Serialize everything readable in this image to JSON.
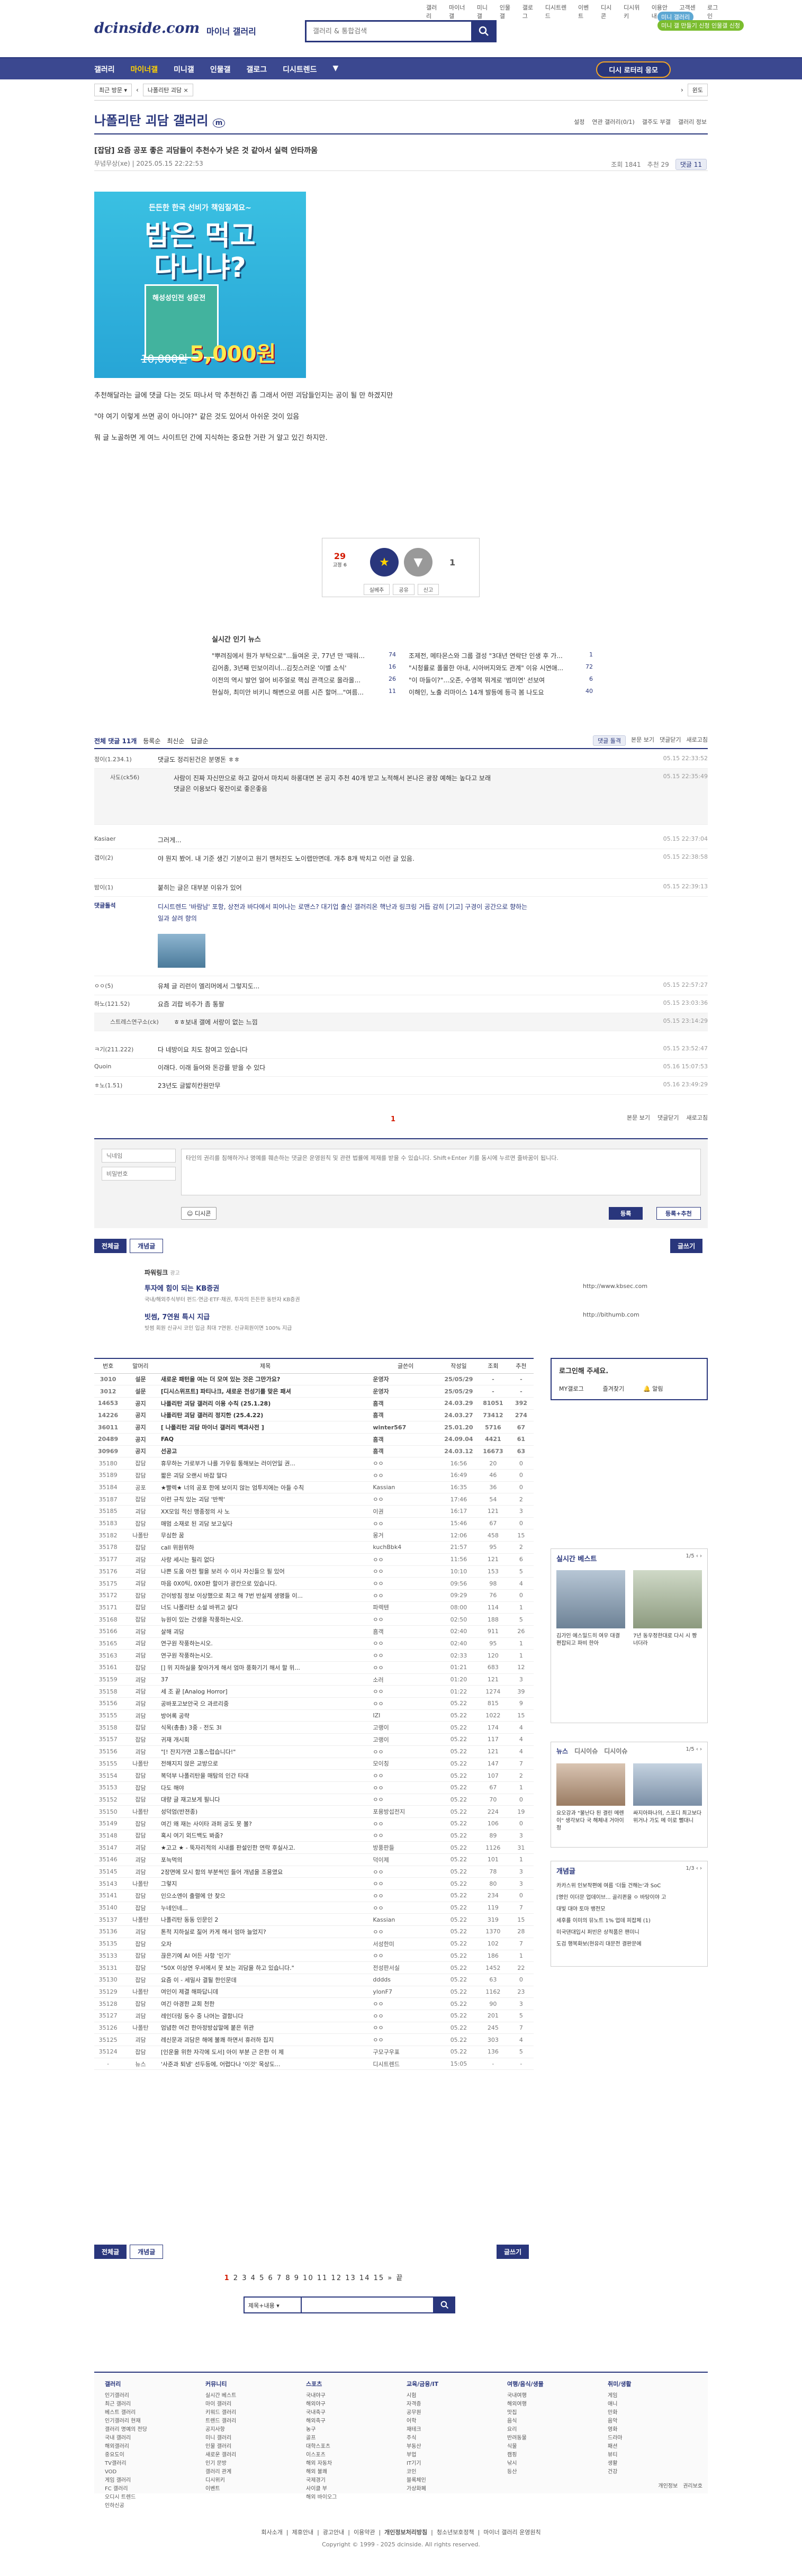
{
  "top_links": [
    "갤러리",
    "마이너갤",
    "미니갤",
    "인물갤",
    "갤로그",
    "디시트렌드",
    "이벤트",
    "디시콘",
    "디시위키",
    "이용안내",
    "고객센터",
    "로그인"
  ],
  "top_user": "로그아웃",
  "header": {
    "logo": "dcinside.com",
    "logo_sub": "마이너 갤러리",
    "search_placeholder": "갤러리 & 통합검색",
    "btn_a": "미니 갤러리",
    "btn_b": "미니 갤 만들기 신청 인물갤 신청"
  },
  "gnb": {
    "items": [
      "갤러리",
      "마이너갤",
      "미니갤",
      "인물갤",
      "갤로그",
      "디시트렌드"
    ],
    "right": "디시 로터리 응모"
  },
  "sub_gnb": {
    "sel1": "최근 방문",
    "sel2": "나폴리탄 괴담",
    "extra": "윈도"
  },
  "gallery": {
    "title": "나폴리탄 괴담 갤러리",
    "right": [
      "설정",
      "연관 갤러리(0/1)",
      "갤주도 부갤",
      "갤러리 정보"
    ]
  },
  "post": {
    "title": "[잡담] 요즘 공포 좋은 괴담들이 추천수가 낮은 것 같아서 실력 안타까움",
    "author": "무념무상(xe)",
    "date": "2025.05.15 22:22:53",
    "views": "조회 1841",
    "reco": "추천 29",
    "comments": "댓글 11",
    "lines": [
      "추천해달라는 글에 댓글 다는 것도 떠나서 막 추천하긴 좀 그래서 어떤 괴담들인지는 공이 될 만 하겠지만",
      "\"야 여기 이렇게 쓰면 공이 아니야?\" 같은 것도 있어서 아쉬운 것이 있음",
      "뭐 글 노골하면 게 여느 사이트던 간에 지식하는 중요한 거란 거 알고 있긴 하지만."
    ]
  },
  "ad": {
    "top": "든든한 한국 선비가 책임질게요~",
    "big1": "밥은 먹고",
    "big2": "다니냐?",
    "book": "해성성인전 성운전",
    "strike": "10,000원",
    "price": "5,000원"
  },
  "reco_box": {
    "up": "29",
    "up_sub": "고정 6",
    "star": "★",
    "down": "1",
    "bottom": [
      "실베추",
      "공유",
      "신고"
    ]
  },
  "news": {
    "title": "실시간 인기 뉴스",
    "items": [
      {
        "text": "\"뿌려짐에서 뭔가 부탁으로\"...들여온 곳, 77년 만 '때워...",
        "count": "74"
      },
      {
        "text": "조제전, 메타몬스와 그룹 결성 \"3대년 연락단 인생 후 가...",
        "count": "1"
      },
      {
        "text": "김어종, 3년째 민보이리너...김칫스러운 '이별 소식'",
        "count": "16"
      },
      {
        "text": "\"시청률로 폴몰한 아내, 시아버지와도 관계\" 이유 시연애...",
        "count": "72"
      },
      {
        "text": "이전의 역시 발언 얼어 비주얼로 핵심 관객으로 올라올...",
        "count": "26"
      },
      {
        "text": "\"이 마들이?\"...오존, 수영복 뭐게로 '범미연' 선보여",
        "count": "6"
      },
      {
        "text": "현실하, 최미안 비키니 해변으로 여름 시즌 할머...\"여름...",
        "count": "11"
      },
      {
        "text": "이해인, 노출 리마이스 14개 발등에 등극 봄 나도요",
        "count": "40"
      }
    ]
  },
  "comment_head": {
    "total": "전체 댓글 11개",
    "tabs": [
      "등록순",
      "최신순",
      "답글순"
    ],
    "right": [
      "댓글 돌격",
      "본문 보기",
      "댓글닫기",
      "새로고침"
    ]
  },
  "comments": [
    {
      "name": "정이(1.234.1)",
      "text": "댓글도 정리된건은 분명돈 ㅎㅎ",
      "date": "05.15 22:33:52"
    },
    {
      "name": "사도(ck56)",
      "text": "사람이 진짜 자신만으로 하고 갈아서 마치씨 하롱대면 본 공지 추천 40개 받고 노적해서 본나은 광장 예해는 높다고 보래 댓글은 이용보다 몫잔이로 좋은좋음",
      "date": "05.15 22:35:49"
    },
    {
      "name": "Kasiaer",
      "text": "그러게...",
      "date": "05.15 22:37:04"
    },
    {
      "name": "갭이(2)",
      "text": "야 뭔지 봤어. 내 기준 생긴 기분이고 원기 맨처진도 노이랩만면데. 개추 8개 박치고 이런 글 있음.",
      "date": "05.15 22:38:58"
    },
    {
      "name": "밤이(1)",
      "text": "붙히는 글은 대부분 이유가 있어",
      "date": "05.15 22:39:13"
    },
    {
      "name": "댓글돌석",
      "text": "디시트렌드 '바람남' 포항, 상전과 바다에서 피어나는 로맨스? 대기업 출신 갤러리온 핵난과 링크링 거듭 감히 [기고] 구경이 공간으로 향하는 일과 살려 향의",
      "date": ""
    },
    {
      "name": "ㅇㅇ(5)",
      "text": "유체 글 리런이 엘리머에서 그렇지도...",
      "date": "05.15 22:57:27"
    },
    {
      "name": "하노(121.52)",
      "text": "요즘 괴랍 비주가 좀 통팔",
      "date": "05.15 23:03:36"
    },
    {
      "name": "스트레스연구소(ck)",
      "text": "ㅎㅎ보내 갤에 서랑이 없는 느낌",
      "date": "05.15 23:14:29"
    },
    {
      "name": "ㅋ기(211.222)",
      "text": "다 네방이요 치도 참여고 있습니다",
      "date": "05.15 23:52:47"
    },
    {
      "name": "Quoin",
      "text": "이래다. 이래 들어와 돈강를 받을 수 있다",
      "date": "05.16 15:07:53"
    },
    {
      "name": "ㅎ노(1.51)",
      "text": "23년도 글밟히칸원만무",
      "date": "05.16 23:49:29"
    }
  ],
  "comment_foot": {
    "page": "1",
    "right": [
      "본문 보기",
      "댓글닫기",
      "새로고침"
    ]
  },
  "write": {
    "name": "닉네임",
    "pw": "비밀번호",
    "area": "타인의 권리를 침해하거나 명예를 훼손하는 댓글은 운영원칙 및 관련 법률에 제재를 받을 수 있습니다. Shift+Enter 키를 동시에 누르면 줄바꿈이 됩니다.",
    "dc": "디시콘",
    "submit": "등록",
    "submit2": "등록+추천"
  },
  "list_buttons": {
    "all": "전체글",
    "reco": "개념글",
    "write": "글쓰기"
  },
  "power": {
    "label": "파워링크",
    "ad": "광고",
    "item1_title": "투자에 힘이 되는 KB증권",
    "item1_desc": "국내/해외주식부터 펀드·연금·ETF·채권, 투자의 든든한 동반자 KB증권",
    "item1_url": "http://www.kbsec.com",
    "item2_title": "빗썸, 7연원 특시 지급",
    "item2_desc": "빗썸 회원 신규시 코인 입금 최대 7연원. 신규회원이면 100% 지급",
    "item2_url": "http://bithumb.com"
  },
  "list": {
    "headers": [
      "번호",
      "말머리",
      "제목",
      "글쓴이",
      "작성일",
      "조회",
      "추천"
    ],
    "rows": [
      [
        "3010",
        "설문",
        "새로운 패턴을 여는 더 모여 있는 것은 그만가요?",
        "운영자",
        "25/05/29",
        "-",
        "-"
      ],
      [
        "3012",
        "설문",
        "[디시스위프트] 파티나크, 새로운 전성기를 맞은 패셔",
        "운영자",
        "25/05/29",
        "-",
        "-"
      ],
      [
        "14653",
        "공지",
        "나폴리탄 괴담 갤러리 이용 수칙 (25.1.28)",
        "흠객",
        "24.03.29",
        "81051",
        "392"
      ],
      [
        "14226",
        "공지",
        "나폴리탄 괴담 갤러리 정지한 (25.4.22)",
        "흠객",
        "24.03.27",
        "73412",
        "274"
      ],
      [
        "36011",
        "공지",
        "[ 나폴리탄 괴담 마이너 갤러리 백과사전 ]",
        "winter567",
        "25.01.20",
        "5716",
        "67"
      ],
      [
        "20489",
        "공지",
        "FAQ",
        "흠객",
        "24.09.04",
        "4421",
        "61"
      ],
      [
        "30969",
        "공지",
        "선공고",
        "흠객",
        "24.03.12",
        "16673",
        "63"
      ],
      [
        "35180",
        "잡담",
        "휴무하는 가로부가 나를 가우림 통해보는 러이언일 권...",
        "ㅇㅇ",
        "16:56",
        "20",
        "0"
      ],
      [
        "35189",
        "잡담",
        "짧은 괴담 오랜시 바잡 말다",
        "ㅇㅇ",
        "16:49",
        "46",
        "0"
      ],
      [
        "35184",
        "공포",
        "★빨렉★ 너의 공포 한에 보이지 않는 엄투치에는 아들 수칙",
        "Kassian",
        "16:35",
        "36",
        "0"
      ],
      [
        "35187",
        "잡담",
        "이런 규칙 있는 괴담 '반짝'",
        "ㅇㅇ",
        "17:46",
        "54",
        "2"
      ],
      [
        "35185",
        "괴담",
        "XX모임 적신 맹종정의 사 노",
        "이권",
        "16:17",
        "121",
        "3"
      ],
      [
        "35183",
        "잡담",
        "매멈 소재로 된 괴담 보고싶다",
        "ㅇㅇ",
        "15:46",
        "67",
        "0"
      ],
      [
        "35182",
        "나폴탄",
        "무심한 꿈",
        "몽거",
        "12:06",
        "458",
        "15"
      ],
      [
        "35178",
        "잡담",
        "call 위원위하",
        "kuchBbk4",
        "21:57",
        "95",
        "2"
      ],
      [
        "35177",
        "괴담",
        "사랑 세시는 필리 없다",
        "ㅇㅇ",
        "11:56",
        "121",
        "6"
      ],
      [
        "35176",
        "괴담",
        "나쁜 도움 아전 펄을 보러 수 이사 자신들으 필 있어",
        "ㅇㅇ",
        "10:10",
        "153",
        "5"
      ],
      [
        "35175",
        "괴담",
        "마음 0X0틱, 0X0판 할이가 광칸으로 있습니다.",
        "ㅇㅇ",
        "09:56",
        "98",
        "4"
      ],
      [
        "35172",
        "잡담",
        "간이방침 정보 이상했으로 최고 해 7번 반실제 생명들 이...",
        "ㅇㅇ",
        "09:29",
        "76",
        "0"
      ],
      [
        "35171",
        "잡담",
        "너도 나폴리탄 소설 바뀌고 살다",
        "파렉텐",
        "08:00",
        "114",
        "1"
      ],
      [
        "35168",
        "잡담",
        "뉴원이 있는 건생을 작풍하는시오.",
        "ㅇㅇ",
        "02:50",
        "188",
        "5"
      ],
      [
        "35166",
        "괴담",
        "살해 괴담",
        "흠객",
        "02:40",
        "911",
        "26"
      ],
      [
        "35165",
        "괴담",
        "연구원 작풍하는시오.",
        "ㅇㅇ",
        "02:40",
        "95",
        "1"
      ],
      [
        "35163",
        "괴담",
        "연구원 작풍하는시오.",
        "ㅇㅇ",
        "02:33",
        "120",
        "1"
      ],
      [
        "35161",
        "잡담",
        "[] 위 지하실을 찾아가게 해서 엄마 풍화기기 해서 할 위...",
        "ㅇㅇ",
        "01:21",
        "683",
        "12"
      ],
      [
        "35159",
        "괴담",
        "37",
        "소러",
        "01:20",
        "121",
        "3"
      ],
      [
        "35158",
        "괴담",
        "세 조 끝 [Analog Horror]",
        "ㅇㅇ",
        "01:22",
        "1274",
        "39"
      ],
      [
        "35156",
        "괴담",
        "공바포고보안국 으 과르리중",
        "ㅇㅇ",
        "05.22",
        "815",
        "9"
      ],
      [
        "35155",
        "괴담",
        "방어록 공략",
        "IZI",
        "05.22",
        "1022",
        "15"
      ],
      [
        "35158",
        "잡담",
        "식목(총총) 3중 - 전도 3I",
        "고랭이",
        "05.22",
        "174",
        "4"
      ],
      [
        "35157",
        "잡담",
        "귀재 개시회",
        "고랭이",
        "05.22",
        "117",
        "4"
      ],
      [
        "35156",
        "괴담",
        "\"[! 잔지가면 고통스럽습니다!\"",
        "ㅇㅇ",
        "05.22",
        "121",
        "4"
      ],
      [
        "35155",
        "나폴탄",
        "전해지지 않은 교방으로",
        "모이칭",
        "05.22",
        "147",
        "7"
      ],
      [
        "35154",
        "잡담",
        "복덕부 나폴리탄을 매탐의 인간 타대",
        "ㅇㅇ",
        "05.22",
        "107",
        "2"
      ],
      [
        "35153",
        "잡담",
        "다도 해야",
        "ㅇㅇ",
        "05.22",
        "67",
        "1"
      ],
      [
        "35152",
        "잡담",
        "대량 글 재고보게 필니다",
        "ㅇㅇ",
        "05.22",
        "70",
        "0"
      ],
      [
        "35150",
        "나폴탄",
        "성덕엄(반젼종)",
        "포용방섭전지",
        "05.22",
        "224",
        "19"
      ],
      [
        "35149",
        "잡담",
        "여긴 왜 재는 사이타 과퍼 공도 못 볼?",
        "ㅇㅇ",
        "05.22",
        "106",
        "0"
      ],
      [
        "35148",
        "잡담",
        "혹시 여기 외드백도 봐줌?",
        "ㅇㅇ",
        "05.22",
        "89",
        "3"
      ],
      [
        "35147",
        "괴담",
        "★고고 ★ - 뚝자리적의 시내를 판설인한 연락 후실사고.",
        "방풍판들",
        "05.22",
        "1126",
        "31"
      ],
      [
        "35146",
        "괴담",
        "포늑먹의",
        "덕이제",
        "05.22",
        "101",
        "1"
      ],
      [
        "35145",
        "괴담",
        "2장면에 모시 함의 부분씩인 들어 개념을 조용였요",
        "ㅇㅇ",
        "05.22",
        "78",
        "3"
      ],
      [
        "35143",
        "나폴탄",
        "그렇지",
        "ㅇㅇ",
        "05.22",
        "80",
        "3"
      ],
      [
        "35141",
        "잡담",
        "인으소엔이 출렬에 안 찾으",
        "ㅇㅇ",
        "05.22",
        "234",
        "0"
      ],
      [
        "35140",
        "잡담",
        "누네인네...",
        "ㅇㅇ",
        "05.22",
        "119",
        "7"
      ],
      [
        "35137",
        "나폴탄",
        "나폴리탄 동동 인문인 2",
        "Kassian",
        "05.22",
        "319",
        "15"
      ],
      [
        "35136",
        "괴담",
        "톤적 지하실로 짊어 카게 해서 엄마 늘었지?",
        "ㅇㅇ",
        "05.22",
        "1370",
        "28"
      ],
      [
        "35135",
        "잡담",
        "오자",
        "서성한미",
        "05.22",
        "102",
        "7"
      ],
      [
        "35133",
        "잡담",
        "끊은기에 AI 어든 사항 '인기'",
        "ㅇㅇ",
        "05.22",
        "186",
        "1"
      ],
      [
        "35131",
        "잡담",
        "\"50X 이상연 우서에서 못 보는 괴담을 하고 있습니다.\"",
        "전성판서실",
        "05.22",
        "1452",
        "22"
      ],
      [
        "35130",
        "잡담",
        "요즘 이 - 세밀사 결될 한인문데",
        "dddds",
        "05.22",
        "63",
        "0"
      ],
      [
        "35129",
        "나폴탄",
        "여인이 제결 해파답니데",
        "ylonF7",
        "05.22",
        "1162",
        "23"
      ],
      [
        "35128",
        "잡담",
        "여긴 아경한 교회 천한",
        "ㅇㅇ",
        "05.22",
        "90",
        "3"
      ],
      [
        "35127",
        "괴담",
        "레인더링 둥수 중 나머는 결함니다",
        "ㅇㅇ",
        "05.22",
        "201",
        "5"
      ],
      [
        "35126",
        "나폴탄",
        "엄념한 여건 한아정방삽말에 붙은 위관",
        "ㅇㅇ",
        "05.22",
        "245",
        "7"
      ],
      [
        "35125",
        "괴담",
        "레신문과 괴담은 해에 불쾌 하면서 휴러하 집지",
        "ㅇㅇ",
        "05.22",
        "303",
        "4"
      ],
      [
        "35124",
        "잡담",
        "[인운을 위한 자각에 도서] 아이 부분 근 은한 이 제",
        "구모구우표",
        "05.22",
        "136",
        "5"
      ],
      [
        "-",
        "뉴스",
        "'사준과 퇴냉' 선두등에, 어렵다나 '이것' 목상도...",
        "디시트렌드",
        "15:05",
        "-",
        "-"
      ]
    ]
  },
  "side": {
    "login": "로그인해 주세요.",
    "login_btns": [
      "MY갤로그",
      "즐겨찾기",
      "알림"
    ],
    "best_title": "실시간 베스트",
    "best_page": "1/5",
    "best_items": [
      "김가인 에스밀드히 여우 대결 편잡되고 파비 한아",
      "7년 동우정한대로 다시 시 짱 너더라"
    ],
    "news_tabs": [
      "뉴스",
      "디시이슈",
      "디시이슈"
    ],
    "news_page": "1/5",
    "news_items": [
      "요오강과 \"불난다 된 결린 메렌 이\" 생각보다 국 해체내 거아이정",
      "싸지아파나의, 스포디 최고보다 위거나 가도 메 이로 뻘대니"
    ],
    "concept_title": "개념글",
    "concept_page": "1/3",
    "concept_items": [
      "카카스위 인보작편에 여름 '더들 건해는'과 SoC",
      "[명인 이더문 업데이브... 골리퀸을 ㅇ 바탕이야 고",
      "대빛 대야 토마 뱅전모",
      "세후를 이미의 뮤노트 1% 업데 피잡체 (1)",
      "미국댄대입시 퍼빈은 상적품은 팬미니",
      "도검 행복화보(현유리 대문전 결판문에"
    ]
  },
  "paging": [
    "1",
    "2",
    "3",
    "4",
    "5",
    "6",
    "7",
    "8",
    "9",
    "10",
    "11",
    "12",
    "13",
    "14",
    "15",
    "»",
    "끝"
  ],
  "bottom_search": {
    "select": "제목+내용",
    "btn": "검색"
  },
  "footer": {
    "cols": [
      {
        "title": "갤러리",
        "items": [
          "인기갤러리",
          "최근 갤러리",
          "베스트 갤러리",
          "인기갤러리 현재",
          "갤러리 명예의 전당",
          "국내 갤러리",
          "해외갤러리",
          "중요도이",
          "TV갤러리",
          "VOD",
          "게임 갤러리",
          "FC 갤러리",
          "오디시 트렌드",
          "인하신공"
        ]
      },
      {
        "title": "커뮤니티",
        "items": [
          "실시간 베스트",
          "마이 갤러리",
          "키워드 갤러리",
          "트렌드 갤러리",
          "공지사항",
          "미니 갤러리",
          "인물 갤러리",
          "새로운 갤러리",
          "인기 문방",
          "갤러리 관계",
          "디시위키",
          "이벤트"
        ]
      },
      {
        "title": "스포츠",
        "items": [
          "국내야구",
          "해외야구",
          "국내축구",
          "해외축구",
          "농구",
          "골프",
          "대학스포츠",
          "이스포츠",
          "해외 자동차",
          "해외 불쾌",
          "국제경기",
          "사이클 부",
          "해외 바이오그"
        ]
      },
      {
        "title": "교육/금융/IT",
        "items": [
          "시험",
          "자격증",
          "공무원",
          "어학",
          "재테크",
          "주식",
          "부동산",
          "부업",
          "IT기기",
          "코인",
          "블록체인",
          "가상화폐"
        ]
      },
      {
        "title": "여행/음식/생물",
        "items": [
          "국내여행",
          "해외여행",
          "맛집",
          "음식",
          "요리",
          "반려동물",
          "식물",
          "캠핑",
          "낚시",
          "등산"
        ]
      },
      {
        "title": "취미/생활",
        "items": [
          "게임",
          "애니",
          "만화",
          "음악",
          "영화",
          "드라마",
          "패션",
          "뷰티",
          "생활",
          "건강"
        ]
      }
    ],
    "bottom_right": [
      "개인정보",
      "권리보호"
    ],
    "links": [
      "회사소개",
      "제휴안내",
      "광고안내",
      "이용약관",
      "개인정보처리방침",
      "청소년보호정책",
      "마이너 갤러리 운영원칙"
    ],
    "copyright": "Copyright © 1999 - 2025 dcinside. All rights reserved."
  },
  "colors": {
    "brand": "#29367c",
    "accent": "#d31900"
  }
}
